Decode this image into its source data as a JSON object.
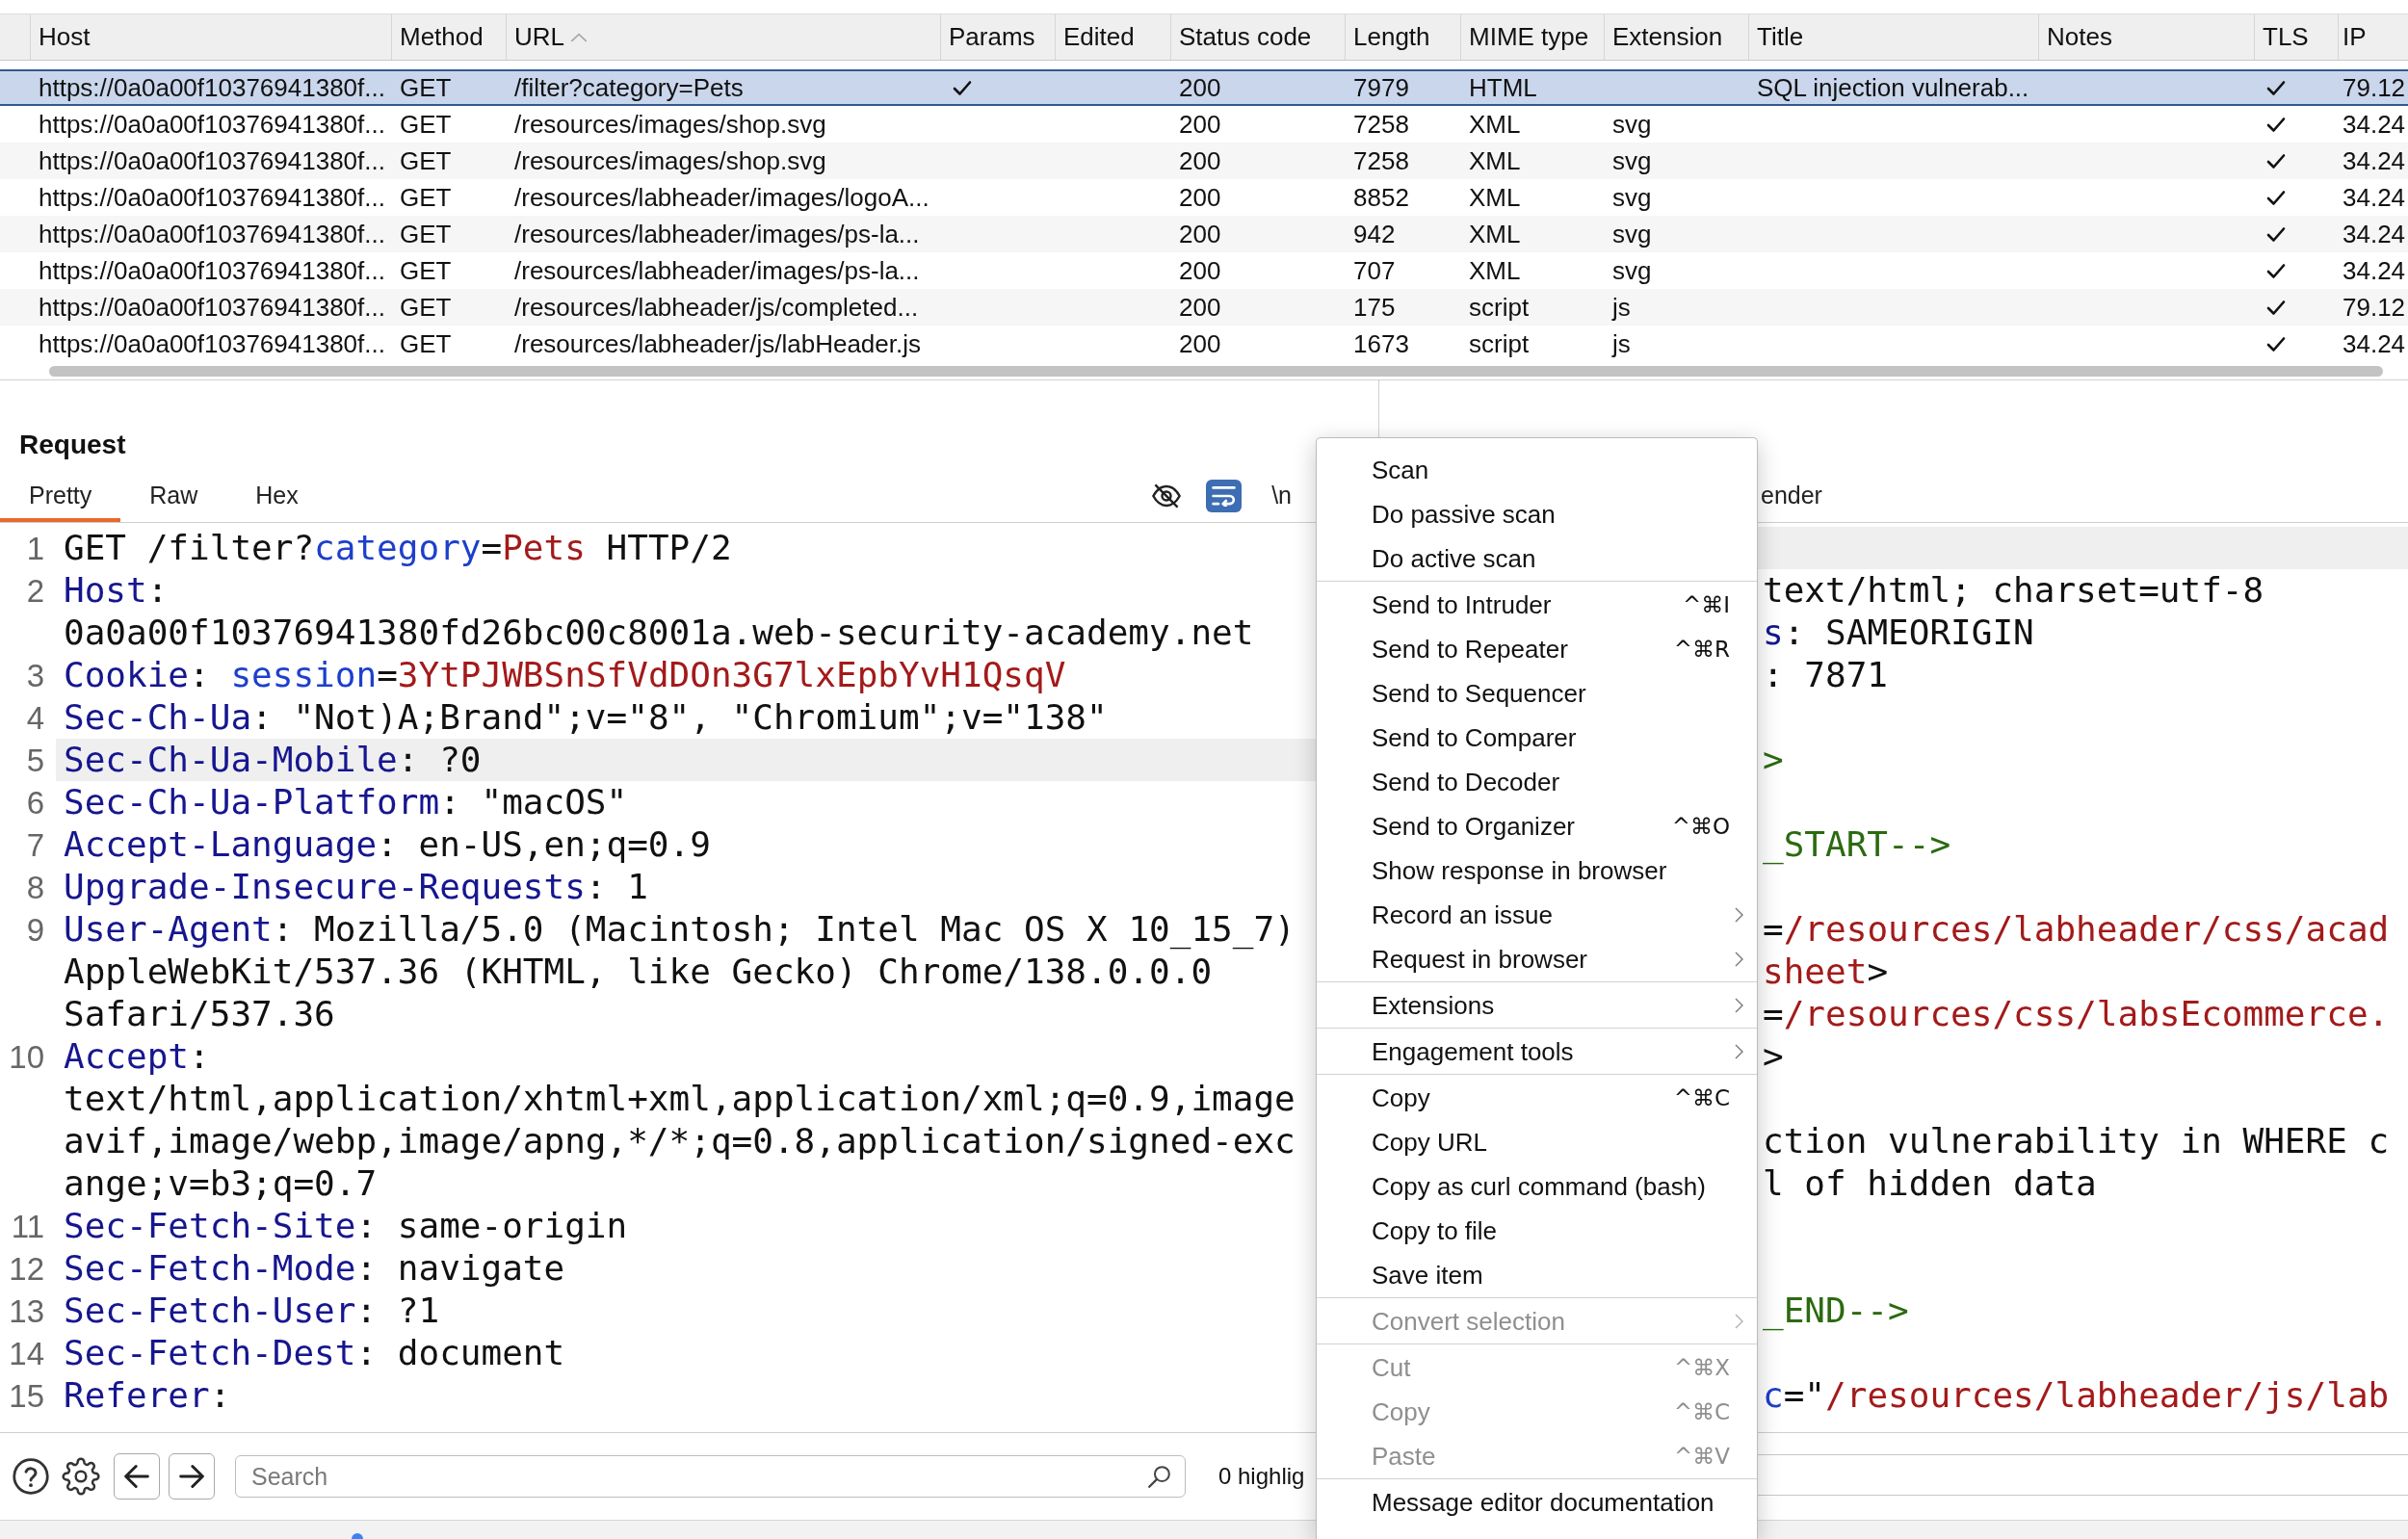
{
  "table": {
    "columns": [
      {
        "label": "Host",
        "sorted": false
      },
      {
        "label": "Method",
        "sorted": false
      },
      {
        "label": "URL",
        "sorted": true
      },
      {
        "label": "Params",
        "sorted": false
      },
      {
        "label": "Edited",
        "sorted": false
      },
      {
        "label": "Status code",
        "sorted": false
      },
      {
        "label": "Length",
        "sorted": false
      },
      {
        "label": "MIME type",
        "sorted": false
      },
      {
        "label": "Extension",
        "sorted": false
      },
      {
        "label": "Title",
        "sorted": false
      },
      {
        "label": "Notes",
        "sorted": false
      },
      {
        "label": "TLS",
        "sorted": false
      },
      {
        "label": "IP",
        "sorted": false
      }
    ],
    "rows": [
      {
        "selected": true,
        "host": "https://0a0a00f10376941380f...",
        "method": "GET",
        "url": "/filter?category=Pets",
        "params": true,
        "status_code": "200",
        "length": "7979",
        "mime_type": "HTML",
        "title": "SQL injection vulnerab...",
        "tls": true,
        "ip": "79.12"
      },
      {
        "selected": false,
        "host": "https://0a0a00f10376941380f...",
        "method": "GET",
        "url": "/resources/images/shop.svg",
        "params": false,
        "status_code": "200",
        "length": "7258",
        "mime_type": "XML",
        "extension": "svg",
        "tls": true,
        "ip": "34.24"
      },
      {
        "selected": false,
        "host": "https://0a0a00f10376941380f...",
        "method": "GET",
        "url": "/resources/images/shop.svg",
        "params": false,
        "status_code": "200",
        "length": "7258",
        "mime_type": "XML",
        "extension": "svg",
        "tls": true,
        "ip": "34.24"
      },
      {
        "selected": false,
        "host": "https://0a0a00f10376941380f...",
        "method": "GET",
        "url": "/resources/labheader/images/logoA...",
        "params": false,
        "status_code": "200",
        "length": "8852",
        "mime_type": "XML",
        "extension": "svg",
        "tls": true,
        "ip": "34.24"
      },
      {
        "selected": false,
        "host": "https://0a0a00f10376941380f...",
        "method": "GET",
        "url": "/resources/labheader/images/ps-la...",
        "params": false,
        "status_code": "200",
        "length": "942",
        "mime_type": "XML",
        "extension": "svg",
        "tls": true,
        "ip": "34.24"
      },
      {
        "selected": false,
        "host": "https://0a0a00f10376941380f...",
        "method": "GET",
        "url": "/resources/labheader/images/ps-la...",
        "params": false,
        "status_code": "200",
        "length": "707",
        "mime_type": "XML",
        "extension": "svg",
        "tls": true,
        "ip": "34.24"
      },
      {
        "selected": false,
        "host": "https://0a0a00f10376941380f...",
        "method": "GET",
        "url": "/resources/labheader/js/completed...",
        "params": false,
        "status_code": "200",
        "length": "175",
        "mime_type": "script",
        "extension": "js",
        "tls": true,
        "ip": "79.12"
      },
      {
        "selected": false,
        "host": "https://0a0a00f10376941380f...",
        "method": "GET",
        "url": "/resources/labheader/js/labHeader.js",
        "params": false,
        "status_code": "200",
        "length": "1673",
        "mime_type": "script",
        "extension": "js",
        "tls": true,
        "ip": "34.24"
      }
    ]
  },
  "request": {
    "title": "Request",
    "tabs": [
      {
        "label": "Pretty",
        "selected": true
      },
      {
        "label": "Raw",
        "selected": false
      },
      {
        "label": "Hex",
        "selected": false
      }
    ],
    "tools": [
      {
        "kind": "hide",
        "selected": false
      },
      {
        "kind": "wrap",
        "selected": true
      },
      {
        "kind": "newline",
        "label": "\\n",
        "selected": false
      }
    ],
    "lines": [
      {
        "number": "1",
        "highlighted": false,
        "rows": [
          [
            {
              "kind": "plain",
              "text": "GET /filter?"
            },
            {
              "kind": "name",
              "text": "category"
            },
            {
              "kind": "plain",
              "text": "="
            },
            {
              "kind": "value",
              "text": "Pets"
            },
            {
              "kind": "plain",
              "text": " HTTP/2"
            }
          ]
        ]
      },
      {
        "number": "2",
        "highlighted": false,
        "rows": [
          [
            {
              "kind": "key",
              "text": "Host"
            },
            {
              "kind": "plain",
              "text": ":"
            }
          ],
          [
            {
              "kind": "plain",
              "text": "0a0a00f10376941380fd26bc00c8001a.web-security-academy.net"
            }
          ]
        ]
      },
      {
        "number": "3",
        "highlighted": false,
        "rows": [
          [
            {
              "kind": "key",
              "text": "Cookie"
            },
            {
              "kind": "plain",
              "text": ": "
            },
            {
              "kind": "name",
              "text": "session"
            },
            {
              "kind": "plain",
              "text": "="
            },
            {
              "kind": "value",
              "text": "3YtPJWBSnSfVdDOn3G7lxEpbYvH1QsqV"
            }
          ]
        ]
      },
      {
        "number": "4",
        "highlighted": false,
        "rows": [
          [
            {
              "kind": "key",
              "text": "Sec-Ch-Ua"
            },
            {
              "kind": "plain",
              "text": ": \"Not)A;Brand\";v=\"8\", \"Chromium\";v=\"138\""
            }
          ]
        ]
      },
      {
        "number": "5",
        "highlighted": true,
        "rows": [
          [
            {
              "kind": "key",
              "text": "Sec-Ch-Ua-Mobile"
            },
            {
              "kind": "plain",
              "text": ": ?0"
            }
          ]
        ]
      },
      {
        "number": "6",
        "highlighted": false,
        "rows": [
          [
            {
              "kind": "key",
              "text": "Sec-Ch-Ua-Platform"
            },
            {
              "kind": "plain",
              "text": ": \"macOS\""
            }
          ]
        ]
      },
      {
        "number": "7",
        "highlighted": false,
        "rows": [
          [
            {
              "kind": "key",
              "text": "Accept-Language"
            },
            {
              "kind": "plain",
              "text": ": en-US,en;q=0.9"
            }
          ]
        ]
      },
      {
        "number": "8",
        "highlighted": false,
        "rows": [
          [
            {
              "kind": "key",
              "text": "Upgrade-Insecure-Requests"
            },
            {
              "kind": "plain",
              "text": ": 1"
            }
          ]
        ]
      },
      {
        "number": "9",
        "highlighted": false,
        "rows": [
          [
            {
              "kind": "key",
              "text": "User-Agent"
            },
            {
              "kind": "plain",
              "text": ": Mozilla/5.0 (Macintosh; Intel Mac OS X 10_15_7)"
            }
          ],
          [
            {
              "kind": "plain",
              "text": "AppleWebKit/537.36 (KHTML, like Gecko) Chrome/138.0.0.0"
            }
          ],
          [
            {
              "kind": "plain",
              "text": "Safari/537.36"
            }
          ]
        ]
      },
      {
        "number": "10",
        "highlighted": false,
        "rows": [
          [
            {
              "kind": "key",
              "text": "Accept"
            },
            {
              "kind": "plain",
              "text": ":"
            }
          ],
          [
            {
              "kind": "plain",
              "text": "text/html,application/xhtml+xml,application/xml;q=0.9,image"
            }
          ],
          [
            {
              "kind": "plain",
              "text": "avif,image/webp,image/apng,*/*;q=0.8,application/signed-exc"
            }
          ],
          [
            {
              "kind": "plain",
              "text": "ange;v=b3;q=0.7"
            }
          ]
        ]
      },
      {
        "number": "11",
        "highlighted": false,
        "rows": [
          [
            {
              "kind": "key",
              "text": "Sec-Fetch-Site"
            },
            {
              "kind": "plain",
              "text": ": same-origin"
            }
          ]
        ]
      },
      {
        "number": "12",
        "highlighted": false,
        "rows": [
          [
            {
              "kind": "key",
              "text": "Sec-Fetch-Mode"
            },
            {
              "kind": "plain",
              "text": ": navigate"
            }
          ]
        ]
      },
      {
        "number": "13",
        "highlighted": false,
        "rows": [
          [
            {
              "kind": "key",
              "text": "Sec-Fetch-User"
            },
            {
              "kind": "plain",
              "text": ": ?1"
            }
          ]
        ]
      },
      {
        "number": "14",
        "highlighted": false,
        "rows": [
          [
            {
              "kind": "key",
              "text": "Sec-Fetch-Dest"
            },
            {
              "kind": "plain",
              "text": ": document"
            }
          ]
        ]
      },
      {
        "number": "15",
        "highlighted": false,
        "rows": [
          [
            {
              "kind": "key",
              "text": "Referer"
            },
            {
              "kind": "plain",
              "text": ":"
            }
          ]
        ]
      }
    ],
    "footer": {
      "search": {
        "placeholder": "Search"
      },
      "highlight_count": "0 highlig"
    }
  },
  "response": {
    "tabs": [
      {
        "label": "ender",
        "selected": false
      }
    ],
    "lines": [
      {
        "kind": "current"
      },
      {
        "kind": "code",
        "segments": [
          {
            "kind": "plain",
            "text": "text/html; charset=utf-8"
          }
        ]
      },
      {
        "kind": "code",
        "segments": [
          {
            "kind": "key",
            "text": "s"
          },
          {
            "kind": "plain",
            "text": ": SAMEORIGIN"
          }
        ]
      },
      {
        "kind": "code",
        "segments": [
          {
            "kind": "plain",
            "text": ": 7871"
          }
        ]
      },
      {
        "kind": "blank"
      },
      {
        "kind": "code",
        "segments": [
          {
            "kind": "comment",
            "text": ">"
          }
        ]
      },
      {
        "kind": "blank"
      },
      {
        "kind": "code",
        "segments": [
          {
            "kind": "comment",
            "text": "_START-->"
          }
        ]
      },
      {
        "kind": "blank"
      },
      {
        "kind": "code",
        "segments": [
          {
            "kind": "plain",
            "text": "="
          },
          {
            "kind": "value",
            "text": "/resources/labheader/css/acad"
          }
        ]
      },
      {
        "kind": "code",
        "segments": [
          {
            "kind": "value",
            "text": "sheet"
          },
          {
            "kind": "plain",
            "text": ">"
          }
        ]
      },
      {
        "kind": "code",
        "segments": [
          {
            "kind": "plain",
            "text": "="
          },
          {
            "kind": "value",
            "text": "/resources/css/labsEcommerce."
          }
        ]
      },
      {
        "kind": "code",
        "segments": [
          {
            "kind": "plain",
            "text": ">"
          }
        ]
      },
      {
        "kind": "blank"
      },
      {
        "kind": "code",
        "segments": [
          {
            "kind": "plain",
            "text": "ction vulnerability in WHERE c"
          }
        ]
      },
      {
        "kind": "code",
        "segments": [
          {
            "kind": "plain",
            "text": "l of hidden data"
          }
        ]
      },
      {
        "kind": "blank"
      },
      {
        "kind": "blank"
      },
      {
        "kind": "code",
        "segments": [
          {
            "kind": "comment",
            "text": "_END-->"
          }
        ]
      },
      {
        "kind": "blank"
      },
      {
        "kind": "code",
        "segments": [
          {
            "kind": "name",
            "text": "c"
          },
          {
            "kind": "plain",
            "text": "=\""
          },
          {
            "kind": "value",
            "text": "/resources/labheader/js/lab"
          }
        ]
      }
    ]
  },
  "context_menu": {
    "groups": [
      [
        {
          "label": "Scan",
          "submenu": false,
          "disabled": false
        },
        {
          "label": "Do passive scan",
          "submenu": false,
          "disabled": false
        },
        {
          "label": "Do active scan",
          "submenu": false,
          "disabled": false
        }
      ],
      [
        {
          "label": "Send to Intruder",
          "shortcut": "^⌘I",
          "submenu": false,
          "disabled": false
        },
        {
          "label": "Send to Repeater",
          "shortcut": "^⌘R",
          "submenu": false,
          "disabled": false
        },
        {
          "label": "Send to Sequencer",
          "submenu": false,
          "disabled": false
        },
        {
          "label": "Send to Comparer",
          "submenu": false,
          "disabled": false
        },
        {
          "label": "Send to Decoder",
          "submenu": false,
          "disabled": false
        },
        {
          "label": "Send to Organizer",
          "shortcut": "^⌘O",
          "submenu": false,
          "disabled": false
        },
        {
          "label": "Show response in browser",
          "submenu": false,
          "disabled": false
        },
        {
          "label": "Record an issue",
          "submenu": true,
          "disabled": false
        },
        {
          "label": "Request in browser",
          "submenu": true,
          "disabled": false
        }
      ],
      [
        {
          "label": "Extensions",
          "submenu": true,
          "disabled": false
        }
      ],
      [
        {
          "label": "Engagement tools",
          "submenu": true,
          "disabled": false
        }
      ],
      [
        {
          "label": "Copy",
          "shortcut": "^⌘C",
          "submenu": false,
          "disabled": false
        },
        {
          "label": "Copy URL",
          "submenu": false,
          "disabled": false
        },
        {
          "label": "Copy as curl command (bash)",
          "submenu": false,
          "disabled": false
        },
        {
          "label": "Copy to file",
          "submenu": false,
          "disabled": false
        },
        {
          "label": "Save item",
          "submenu": false,
          "disabled": false
        }
      ],
      [
        {
          "label": "Convert selection",
          "submenu": true,
          "disabled": true
        }
      ],
      [
        {
          "label": "Cut",
          "shortcut": "^⌘X",
          "submenu": false,
          "disabled": true
        },
        {
          "label": "Copy",
          "shortcut": "^⌘C",
          "submenu": false,
          "disabled": true
        },
        {
          "label": "Paste",
          "shortcut": "^⌘V",
          "submenu": false,
          "disabled": true
        }
      ],
      [
        {
          "label": "Message editor documentation",
          "submenu": false,
          "disabled": false
        }
      ]
    ]
  }
}
